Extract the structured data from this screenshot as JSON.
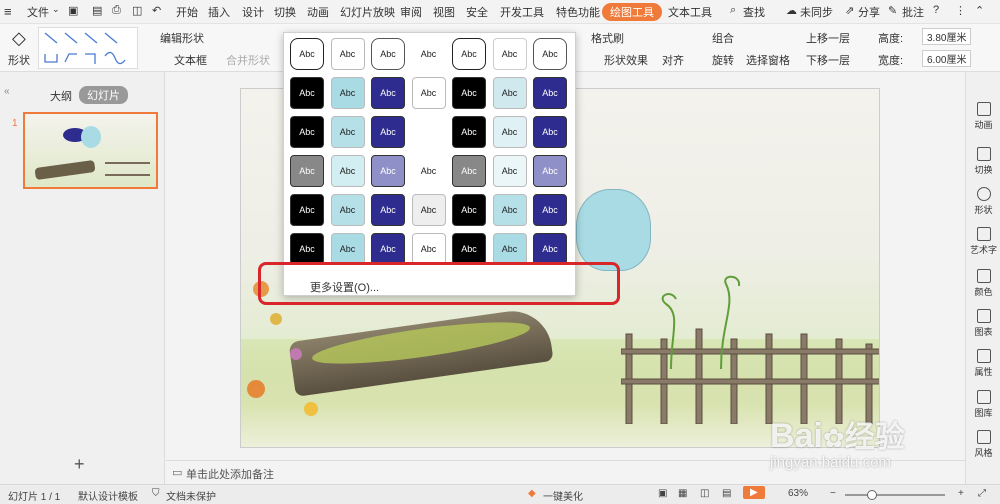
{
  "menu": {
    "file": "文件",
    "tabs": [
      "开始",
      "插入",
      "设计",
      "切换",
      "动画",
      "幻灯片放映",
      "审阅",
      "视图",
      "安全",
      "开发工具",
      "特色功能"
    ],
    "active_tab": "绘图工具",
    "text_tool": "文本工具",
    "search": "查找",
    "unsynced": "未同步",
    "share": "分享",
    "annotate": "批注"
  },
  "ribbon": {
    "shape": "形状",
    "edit_shape": "编辑形状",
    "text_box": "文本框",
    "merge_shape": "合并形状",
    "format_brush": "格式刷",
    "shape_effect": "形状效果",
    "align": "对齐",
    "group": "组合",
    "rotate": "旋转",
    "select_pane": "选择窗格",
    "bring_forward": "上移一层",
    "send_backward": "下移一层",
    "height_label": "高度:",
    "height_value": "3.80厘米",
    "width_label": "宽度:",
    "width_value": "6.00厘米"
  },
  "left_panel": {
    "tab_outline": "大纲",
    "tab_slides": "幻灯片",
    "slide_number": "1",
    "add_button": "+"
  },
  "right_bar": [
    "动画",
    "切换",
    "形状",
    "艺术字",
    "颜色",
    "图表",
    "属性",
    "图库",
    "风格"
  ],
  "dropdown": {
    "swatch_label": "Abc",
    "more_settings": "更多设置(O)..."
  },
  "notes_hint": "单击此处添加备注",
  "status": {
    "slide_count": "幻灯片 1 / 1",
    "template": "默认设计模板",
    "protection": "文档未保护",
    "beautify": "一键美化",
    "zoom": "63%"
  },
  "watermark": {
    "brand": "Bai",
    "brand_cn": "经验",
    "url": "jingyan.baidu.com"
  },
  "colors": {
    "accent": "#f07a3a",
    "highlight_box": "#d9262a",
    "swatch_blue": "#2e2d8f",
    "swatch_teal": "#a8dbe4"
  }
}
